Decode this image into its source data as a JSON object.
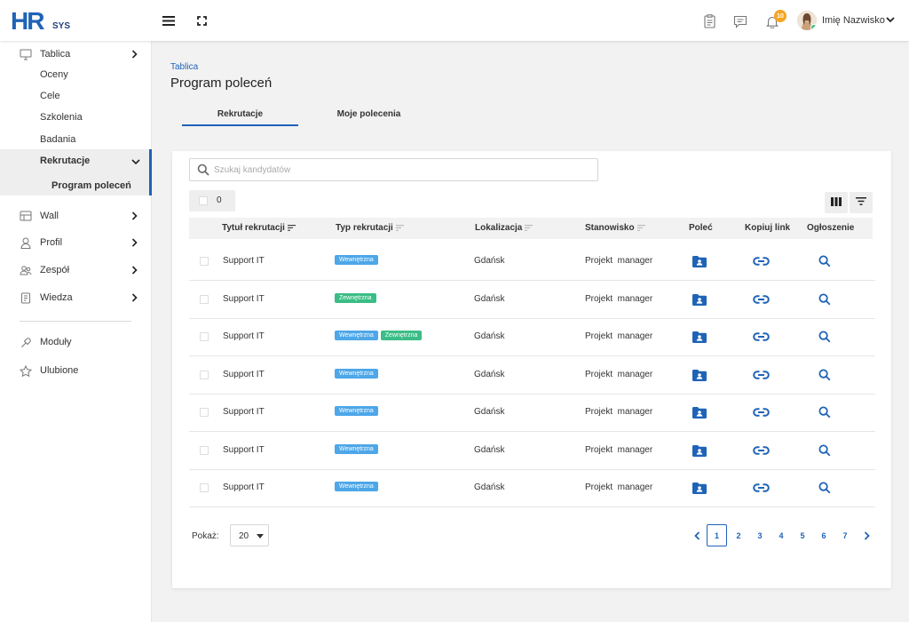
{
  "app": {
    "logo_main": "HR",
    "logo_sub": "SYS",
    "notifications_count": "10",
    "user_name": "Imię Nazwisko",
    "colors": {
      "accent": "#1f63b6",
      "tag_internal": "#4da7e8",
      "tag_external": "#3bbd86",
      "badge": "#f5a623"
    }
  },
  "sidebar": {
    "items": [
      {
        "label": "Tablica",
        "icon": "monitor-icon"
      },
      {
        "label": "Wall",
        "icon": "wall-icon"
      },
      {
        "label": "Profil",
        "icon": "person-icon"
      },
      {
        "label": "Zespół",
        "icon": "team-icon"
      },
      {
        "label": "Wiedza",
        "icon": "book-icon"
      },
      {
        "label": "Moduły",
        "icon": "puzzle-icon"
      },
      {
        "label": "Ulubione",
        "icon": "star-icon"
      }
    ],
    "sub_items": [
      "Oceny",
      "Cele",
      "Szkolenia",
      "Badania"
    ],
    "active_group": "Rekrutacje",
    "active_sub": "Program poleceń"
  },
  "main": {
    "breadcrumb": "Tablica",
    "title": "Program poleceń",
    "tabs": [
      "Rekrutacje",
      "Moje polecenia"
    ],
    "active_tab": "Rekrutacje",
    "search_placeholder": "Szukaj kandydatów",
    "selected_count": "0",
    "columns": [
      "Tytuł rekrutacji",
      "Typ rekrutacji",
      "Lokalizacja",
      "Stanowisko",
      "Poleć",
      "Kopiuj link",
      "Ogłoszenie"
    ],
    "rows": [
      {
        "title": "Support IT",
        "types": [
          "Wewnętrzna"
        ],
        "location": "Gdańsk",
        "position": "Projekt  manager"
      },
      {
        "title": "Support IT",
        "types": [
          "Zewnętrzna"
        ],
        "location": "Gdańsk",
        "position": "Projekt  manager"
      },
      {
        "title": "Support IT",
        "types": [
          "Wewnętrzna",
          "Zewnętrzna"
        ],
        "location": "Gdańsk",
        "position": "Projekt  manager"
      },
      {
        "title": "Support IT",
        "types": [
          "Wewnętrzna"
        ],
        "location": "Gdańsk",
        "position": "Projekt  manager"
      },
      {
        "title": "Support IT",
        "types": [
          "Wewnętrzna"
        ],
        "location": "Gdańsk",
        "position": "Projekt  manager"
      },
      {
        "title": "Support IT",
        "types": [
          "Wewnętrzna"
        ],
        "location": "Gdańsk",
        "position": "Projekt  manager"
      },
      {
        "title": "Support IT",
        "types": [
          "Wewnętrzna"
        ],
        "location": "Gdańsk",
        "position": "Projekt  manager"
      }
    ],
    "page_size_label": "Pokaż:",
    "page_size": "20",
    "pages": [
      "1",
      "2",
      "3",
      "4",
      "5",
      "6",
      "7"
    ],
    "current_page": "1"
  }
}
